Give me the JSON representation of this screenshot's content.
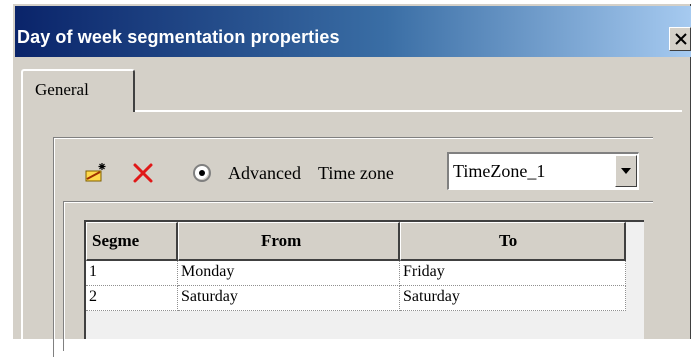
{
  "window": {
    "title": "Day of week segmentation properties",
    "close_icon": "close-x-icon"
  },
  "tabs": [
    {
      "label": "General",
      "selected": true
    }
  ],
  "toolbar": {
    "add_icon": "add-segment-icon",
    "delete_icon": "delete-x-icon",
    "delete_color": "#e01818",
    "radio_label": "Advanced",
    "radio_checked": true,
    "timezone_label": "Time zone",
    "timezone_value": "TimeZone_1"
  },
  "table": {
    "columns": [
      "Segme",
      "From",
      "To"
    ],
    "rows": [
      {
        "segment": "1",
        "from": "Monday",
        "to": "Friday"
      },
      {
        "segment": "2",
        "from": "Saturday",
        "to": "Saturday"
      }
    ]
  },
  "colors": {
    "title_gradient_start": "#0a246a",
    "title_gradient_end": "#a6caf0",
    "dialog_face": "#d4d0c8"
  }
}
